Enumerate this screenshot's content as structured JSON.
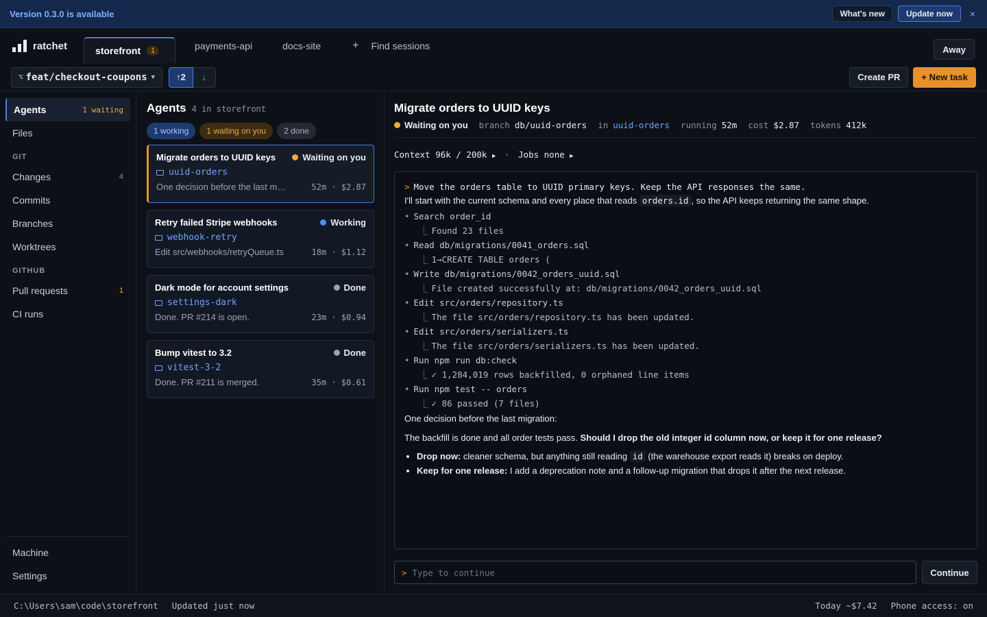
{
  "banner": {
    "message": "Version 0.3.0 is available",
    "whats_new": "What's new",
    "update_now": "Update now",
    "close": "×"
  },
  "app": {
    "name": "ratchet"
  },
  "tabs": [
    {
      "label": "storefront",
      "badge": "1"
    },
    {
      "label": "payments-api"
    },
    {
      "label": "docs-site"
    }
  ],
  "topbar": {
    "add": "+",
    "find": "Find sessions",
    "away": "Away"
  },
  "branchbar": {
    "branch": "feat/checkout-coupons",
    "ahead": "↑2",
    "behind": "↓",
    "create_pr": "Create PR",
    "new_task": "+ New task"
  },
  "sidebar": {
    "agents": {
      "label": "Agents",
      "count": "1 waiting"
    },
    "files": "Files",
    "git_section": "GIT",
    "changes": {
      "label": "Changes",
      "count": "4"
    },
    "commits": "Commits",
    "branches": "Branches",
    "worktrees": "Worktrees",
    "github_section": "GITHUB",
    "pull_requests": {
      "label": "Pull requests",
      "count": "1"
    },
    "ci_runs": "CI runs",
    "machine": "Machine",
    "settings": "Settings"
  },
  "agents_panel": {
    "title": "Agents",
    "subtitle": "4 in storefront",
    "filters": [
      "1 working",
      "1 waiting on you",
      "2 done"
    ],
    "cards": [
      {
        "title": "Migrate orders to UUID keys",
        "status": "Waiting on you",
        "status_color": "#f0a840",
        "worktree": "uuid-orders",
        "desc": "One decision before the last migration",
        "meta": "52m · $2.87"
      },
      {
        "title": "Retry failed Stripe webhooks",
        "status": "Working",
        "status_color": "#4c8dff",
        "worktree": "webhook-retry",
        "desc": "Edit src/webhooks/retryQueue.ts",
        "meta": "18m · $1.12"
      },
      {
        "title": "Dark mode for account settings",
        "status": "Done",
        "status_color": "#9aa3b0",
        "worktree": "settings-dark",
        "desc": "Done. PR #214 is open.",
        "meta": "23m · $0.94"
      },
      {
        "title": "Bump vitest to 3.2",
        "status": "Done",
        "status_color": "#9aa3b0",
        "worktree": "vitest-3-2",
        "desc": "Done. PR #211 is merged.",
        "meta": "35m · $0.61"
      }
    ]
  },
  "detail": {
    "title": "Migrate orders to UUID keys",
    "status": "Waiting on you",
    "branch_k": "branch",
    "branch_v": "db/uuid-orders",
    "in_k": "in",
    "in_v": "uuid-orders",
    "running_k": "running",
    "running_v": "52m",
    "cost_k": "cost",
    "cost_v": "$2.87",
    "tokens_k": "tokens",
    "tokens_v": "412k",
    "context": "Context 96k / 200k",
    "context_sep": "·",
    "jobs": "Jobs none",
    "transcript": {
      "prompt": "Move the orders table to UUID primary keys. Keep the API responses the same.",
      "intro_pre": "I'll start with the current schema and every place that reads ",
      "intro_code": "orders.id",
      "intro_post": ", so the API keeps returning the same shape.",
      "steps": [
        {
          "action": "Search order_id",
          "result": "Found 23 files"
        },
        {
          "action": "Read db/migrations/0041_orders.sql",
          "result": "1→CREATE TABLE orders ("
        },
        {
          "action": "Write db/migrations/0042_orders_uuid.sql",
          "result": "File created successfully at: db/migrations/0042_orders_uuid.sql"
        },
        {
          "action": "Edit src/orders/repository.ts",
          "result": "The file src/orders/repository.ts has been updated."
        },
        {
          "action": "Edit src/orders/serializers.ts",
          "result": "The file src/orders/serializers.ts has been updated."
        },
        {
          "action": "Run npm run db:check",
          "result": "✓ 1,284,019 rows backfilled, 0 orphaned line items"
        },
        {
          "action": "Run npm test -- orders",
          "result": "✓ 86 passed (7 files)"
        }
      ],
      "decision_intro": "One decision before the last migration:",
      "question_pre": "The backfill is done and all order tests pass. ",
      "question_bold": "Should I drop the old integer id column now, or keep it for one release?",
      "option1_bold": "Drop now:",
      "option1_pre": " cleaner schema, but anything still reading ",
      "option1_code": "id",
      "option1_post": " (the warehouse export reads it) breaks on deploy.",
      "option2_bold": "Keep for one release:",
      "option2_text": " I add a deprecation note and a follow-up migration that drops it after the next release."
    },
    "composer": {
      "placeholder": "Type to continue",
      "continue": "Continue"
    }
  },
  "statusbar": {
    "path": "C:\\Users\\sam\\code\\storefront",
    "updated": "Updated just now",
    "today": "Today ~$7.42",
    "phone": "Phone access: on"
  }
}
